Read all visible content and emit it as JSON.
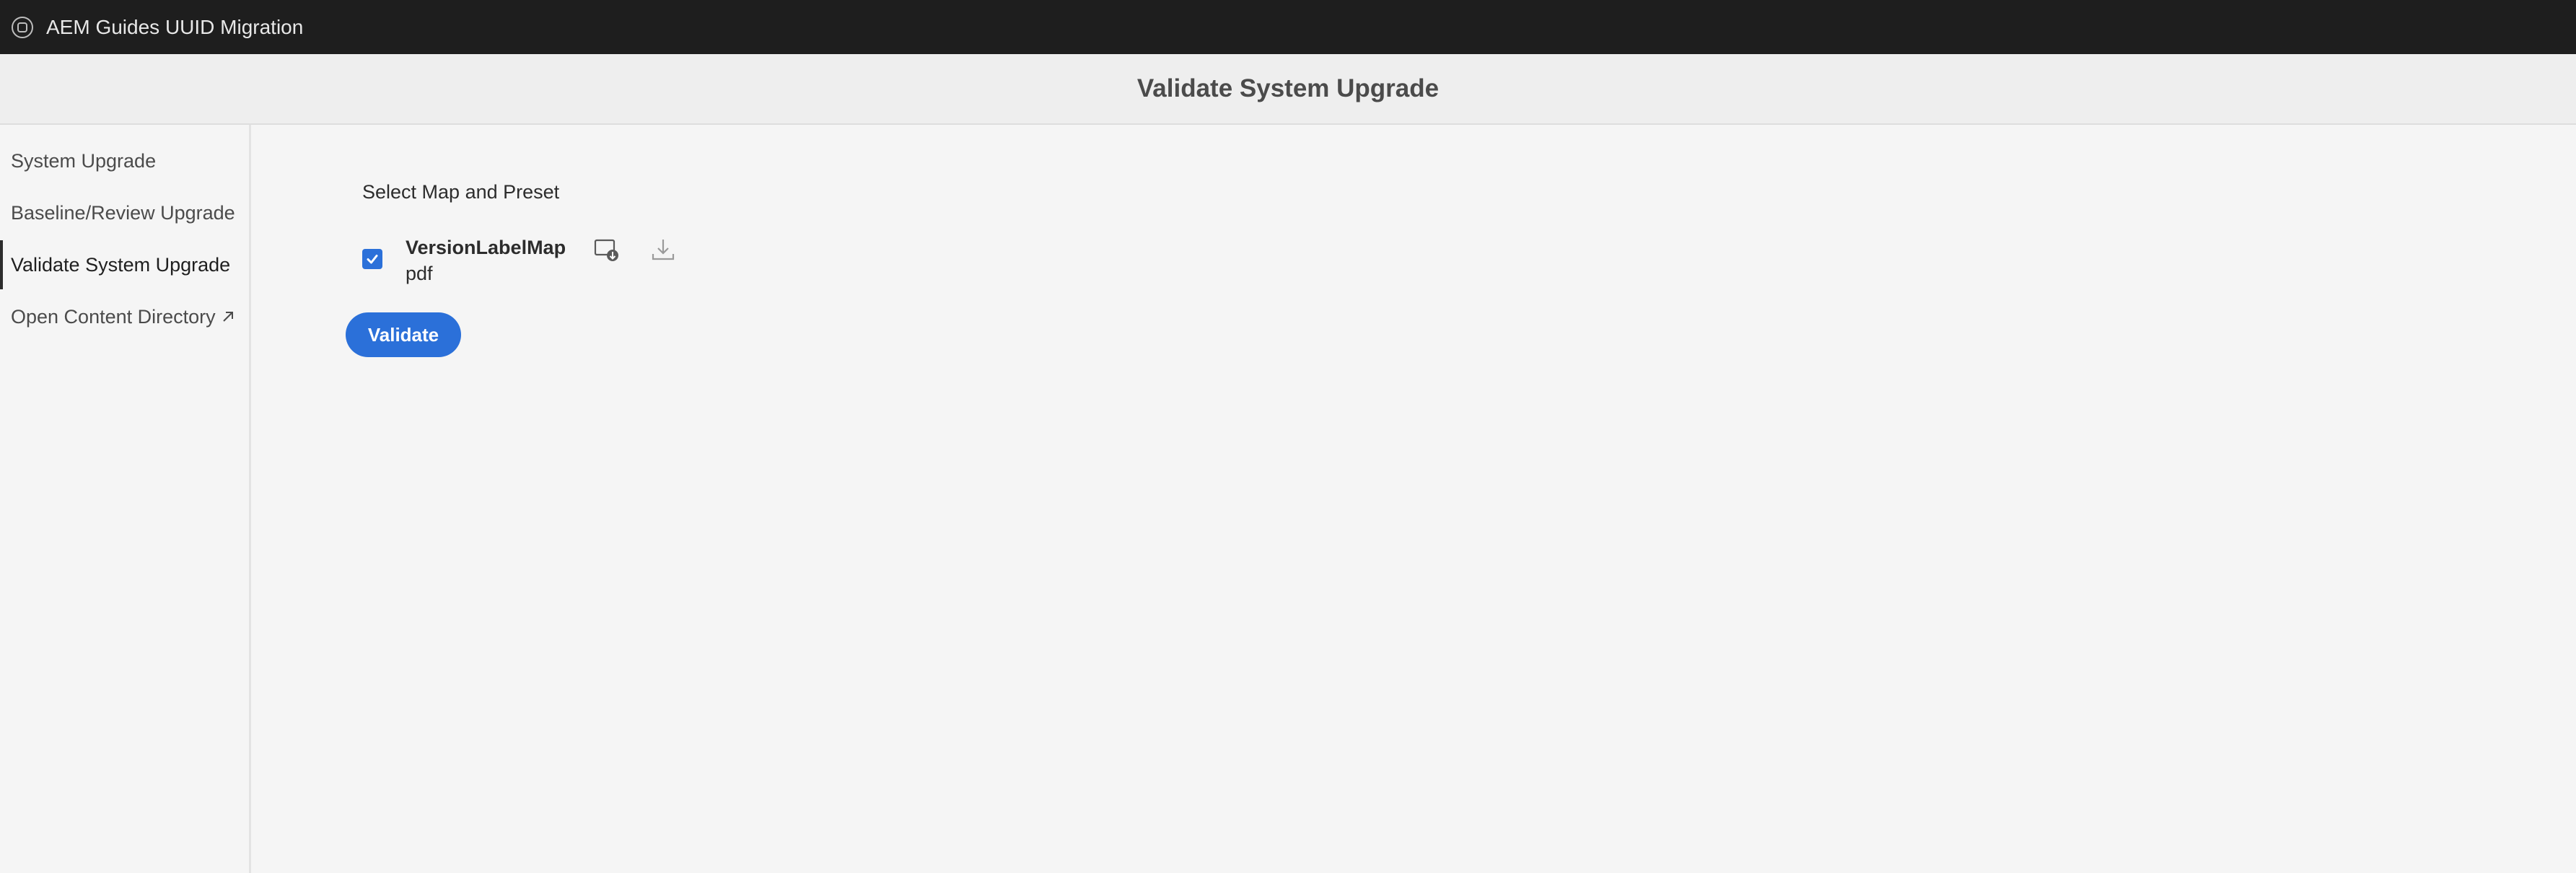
{
  "app": {
    "title": "AEM Guides UUID Migration",
    "icon": "aem-logo-icon"
  },
  "header": {
    "title": "Validate System Upgrade"
  },
  "sidebar": {
    "items": [
      {
        "label": "System Upgrade",
        "selected": false
      },
      {
        "label": "Baseline/Review Upgrade",
        "selected": false
      },
      {
        "label": "Validate System Upgrade",
        "selected": true
      },
      {
        "label": "Open Content Directory",
        "selected": false,
        "icon": "external-link-icon"
      }
    ]
  },
  "main": {
    "section_label": "Select Map and Preset",
    "maps": [
      {
        "name": "VersionLabelMap",
        "preset": "pdf",
        "checked": true,
        "actions": [
          "generate-output-icon",
          "download-icon"
        ]
      }
    ],
    "validate_label": "Validate"
  },
  "colors": {
    "accent": "#2b70d9",
    "topbar": "#1e1e1e",
    "background": "#f5f5f5"
  }
}
